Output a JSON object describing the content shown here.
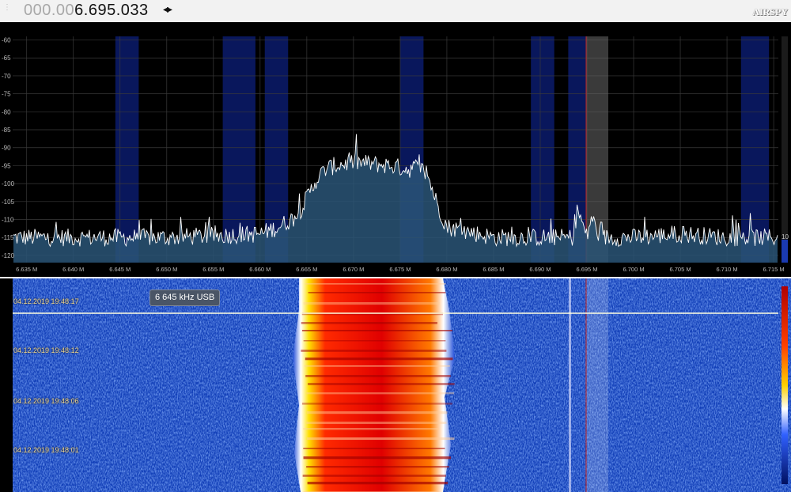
{
  "frequency_display": {
    "prefix": "000.00",
    "value": "6.695.033",
    "tuning_arrows": "◂▸"
  },
  "logo": "AIRSPY",
  "spectrum": {
    "db_axis_labels": [
      "-60",
      "-65",
      "-70",
      "-75",
      "-80",
      "-85",
      "-90",
      "-95",
      "-100",
      "-105",
      "-110",
      "-115",
      "-120"
    ],
    "freq_axis_labels": [
      "6.635 M",
      "6.640 M",
      "6.645 M",
      "6.650 M",
      "6.655 M",
      "6.660 M",
      "6.665 M",
      "6.670 M",
      "6.675 M",
      "6.680 M",
      "6.685 M",
      "6.690 M",
      "6.695 M",
      "6.700 M",
      "6.705 M",
      "6.710 M",
      "6.715 M"
    ],
    "right_scale_label": "10",
    "colors": {
      "background": "#000000",
      "trace": "#ffffff",
      "fill": "#2a5577",
      "band_highlight": "#0a1a66",
      "vfo_marker": "#c02020"
    }
  },
  "chart_data": {
    "type": "area",
    "xlabel": "",
    "ylabel": "",
    "xlim": [
      6.6335,
      6.7155
    ],
    "ylim": [
      -122,
      -59
    ],
    "x": [
      6.634,
      6.64,
      6.65,
      6.66,
      6.662,
      6.664,
      6.665,
      6.666,
      6.667,
      6.668,
      6.67,
      6.672,
      6.674,
      6.676,
      6.677,
      6.678,
      6.679,
      6.68,
      6.685,
      6.69,
      6.6935,
      6.694,
      6.695,
      6.6955,
      6.696,
      6.6965,
      6.7,
      6.705,
      6.71,
      6.715
    ],
    "y": [
      -115,
      -115,
      -115,
      -114,
      -112,
      -109,
      -104,
      -99,
      -96,
      -95,
      -94,
      -94.5,
      -95,
      -96,
      -95,
      -98,
      -106,
      -112,
      -115,
      -115,
      -115,
      -107,
      -115,
      -109,
      -113,
      -115,
      -115,
      -114,
      -115,
      -115
    ],
    "grid": true
  },
  "waterfall": {
    "mode_badge": "6 645 kHz USB",
    "timestamps": [
      "04.12.2019 19:48:17",
      "04.12.2019 19:48:12",
      "04.12.2019 19:48:06",
      "04.12.2019 19:48:01"
    ]
  }
}
